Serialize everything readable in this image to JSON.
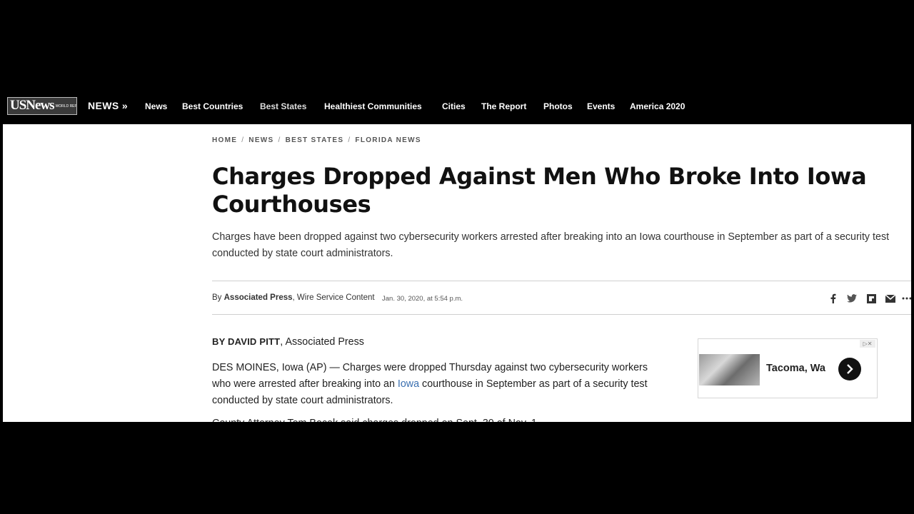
{
  "site": {
    "logo_text": "USNews",
    "logo_tagline": "WORLD REPORT"
  },
  "nav": {
    "section_label": "NEWS »",
    "items": [
      {
        "label": "News"
      },
      {
        "label": "Best Countries"
      },
      {
        "label": "Best States",
        "active": true
      },
      {
        "label": "Healthiest Communities"
      },
      {
        "label": "Cities"
      },
      {
        "label": "The Report"
      },
      {
        "label": "Photos"
      },
      {
        "label": "Events"
      },
      {
        "label": "America 2020"
      }
    ]
  },
  "breadcrumb": [
    "HOME",
    "NEWS",
    "BEST STATES",
    "FLORIDA NEWS"
  ],
  "article": {
    "headline": "Charges Dropped Against Men Who Broke Into Iowa Courthouses",
    "dek": "Charges have been dropped against two cybersecurity workers arrested after breaking into an Iowa courthouse in September as part of a security test conducted by state court administrators.",
    "byline_prefix": "By ",
    "byline_source": "Associated Press",
    "byline_type": ", Wire Service Content",
    "date": "Jan. 30, 2020, at 5:54 p.m.",
    "author_name": "BY DAVID PITT",
    "author_org": ", Associated Press",
    "para1_a": "DES MOINES, Iowa (AP) — Charges were dropped Thursday against two cybersecurity workers who were arrested after breaking into an ",
    "para1_link": "Iowa",
    "para1_b": " courthouse in September as part of a security test conducted by state court administrators.",
    "para2_partial": "County     Attorney     Tom     Bocek     said     charges     dropped     on     Sept.     30     of     Nov.     1"
  },
  "share_icons": [
    "facebook-icon",
    "twitter-icon",
    "flipboard-icon",
    "email-icon",
    "more-icon"
  ],
  "ad": {
    "text": "Tacoma, Wa"
  }
}
